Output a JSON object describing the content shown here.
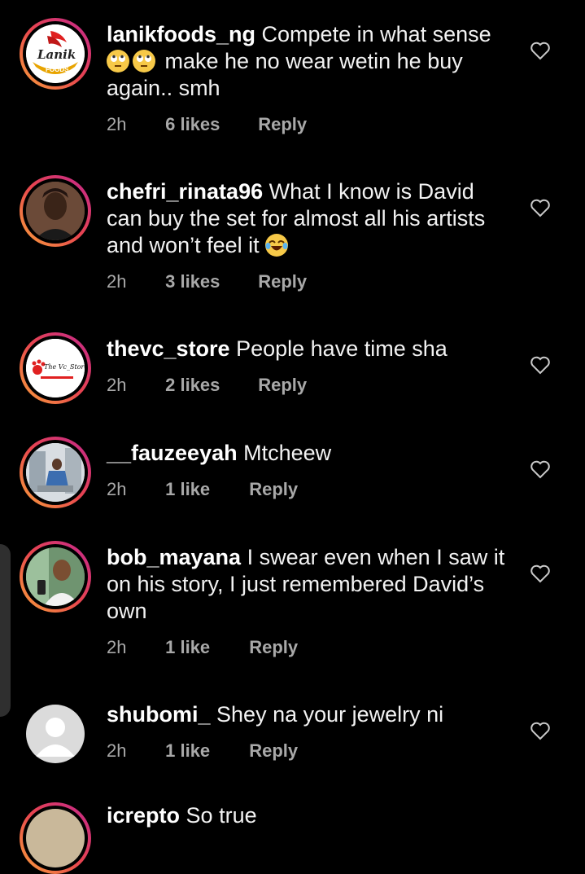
{
  "comments": [
    {
      "username": "lanikfoods_ng",
      "text_before": "Compete in what sense",
      "emojis": [
        "rolling-eyes",
        "rolling-eyes"
      ],
      "text_after": "make he no wear wetin he buy again.. smh",
      "time": "2h",
      "likes": "6 likes",
      "reply": "Reply",
      "avatar_text": "Lanik",
      "avatar_subtext": "FOODS"
    },
    {
      "username": "chefri_rinata96",
      "text_before": "What I know is David can buy the set for almost all his artists and won’t feel it",
      "emojis": [
        "tears-of-joy"
      ],
      "time": "2h",
      "likes": "3 likes",
      "reply": "Reply"
    },
    {
      "username": "thevc_store",
      "text_before": "People have time sha",
      "time": "2h",
      "likes": "2 likes",
      "reply": "Reply",
      "avatar_text": "The Vc_Store"
    },
    {
      "username": "__fauzeeyah",
      "text_before": "Mtcheew",
      "time": "2h",
      "likes": "1 like",
      "reply": "Reply"
    },
    {
      "username": "bob_mayana",
      "text_before": "I swear even when I saw it on his story, I just remembered David’s own",
      "time": "2h",
      "likes": "1 like",
      "reply": "Reply"
    },
    {
      "username": "shubomi_",
      "text_before": "Shey na your jewelry ni",
      "time": "2h",
      "likes": "1 like",
      "reply": "Reply"
    },
    {
      "username": "icrepto",
      "text_before": "So true"
    }
  ],
  "colors": {
    "background": "#000000",
    "meta_gray": "#a8a8a8",
    "story_ring_start": "#f9a23a",
    "story_ring_end": "#c2268f"
  }
}
